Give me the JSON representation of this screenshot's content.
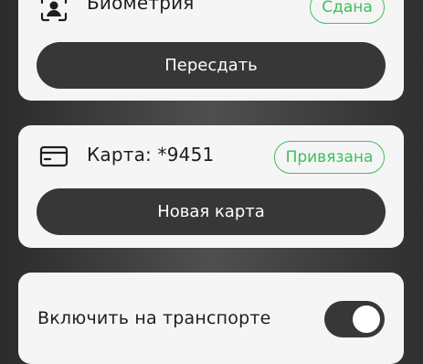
{
  "biometrics": {
    "label": "Биометрия",
    "icon": "face-id-icon",
    "status": "Сдана",
    "button": "Пересдать"
  },
  "bank_card": {
    "label": "Карта: *9451",
    "icon": "credit-card-icon",
    "status": "Привязана",
    "button": "Новая карта"
  },
  "transport": {
    "label": "Включить на транспорте",
    "toggle_on": true
  },
  "colors": {
    "accent_green": "#3fbf5c",
    "button_dark": "#373737",
    "card_bg": "#f5f5f5"
  }
}
